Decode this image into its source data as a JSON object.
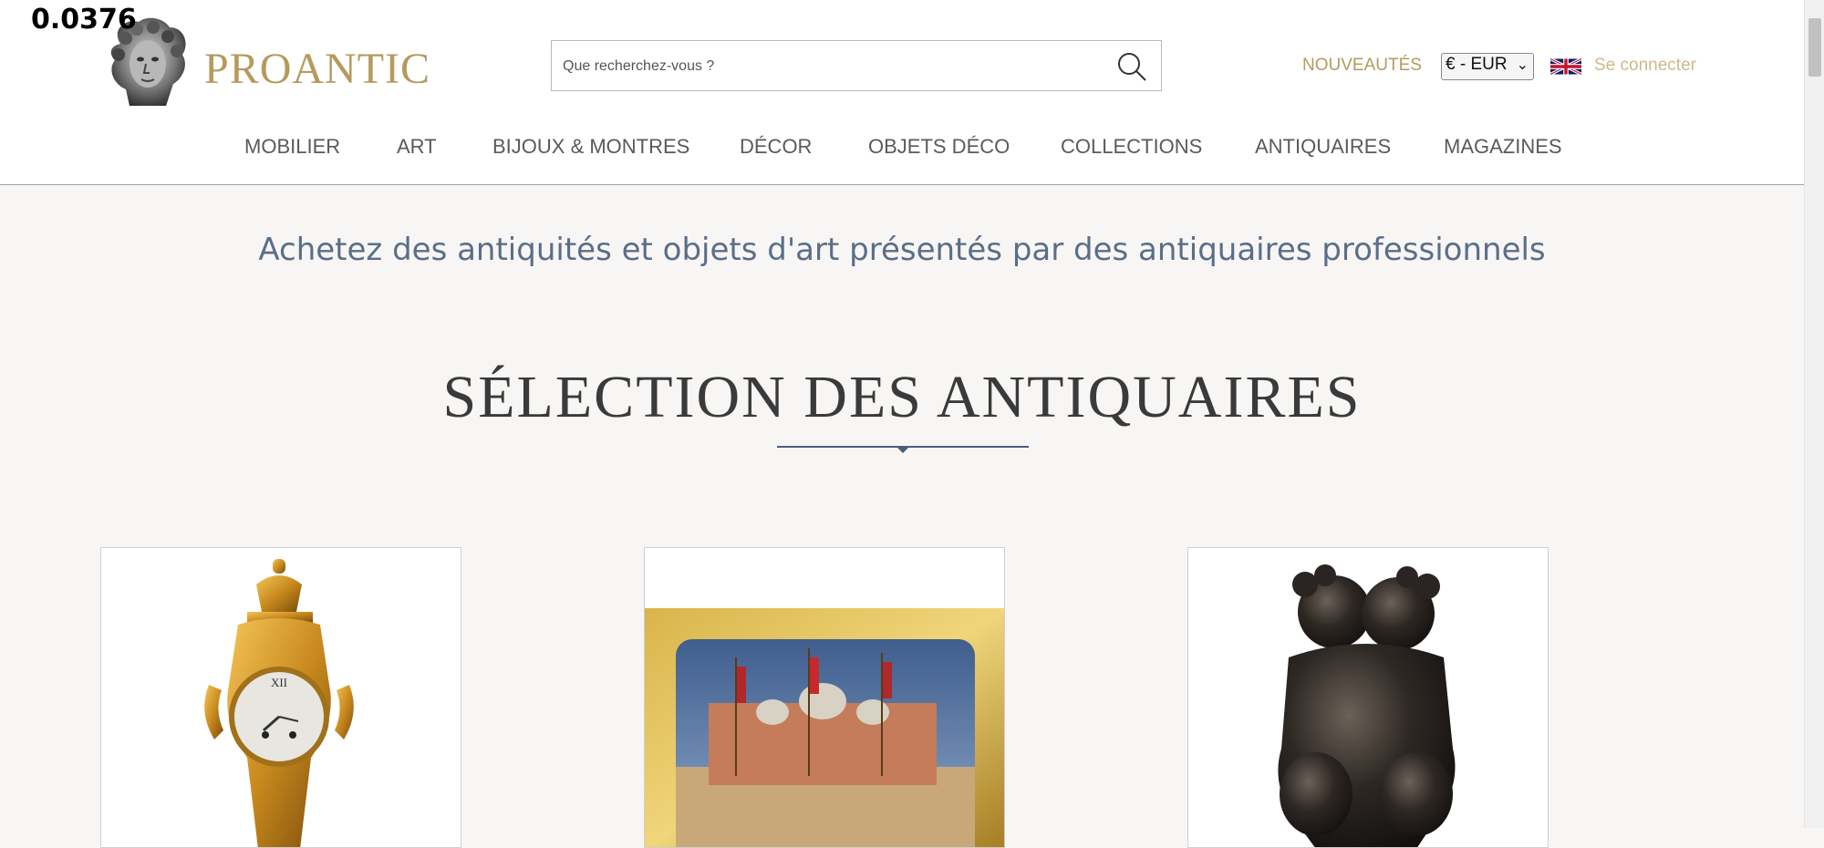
{
  "overlay": {
    "value": "0.0376"
  },
  "header": {
    "logo_text": "PROANTIC",
    "search_placeholder": "Que recherchez-vous ?",
    "new_label": "NOUVEAUTÉS",
    "currency": "€ - EUR",
    "login_label": "Se connecter",
    "language_icon": "uk-flag-icon"
  },
  "nav": {
    "items": [
      "MOBILIER",
      "ART",
      "BIJOUX & MONTRES",
      "DÉCOR",
      "OBJETS DÉCO",
      "COLLECTIONS",
      "ANTIQUAIRES",
      "MAGAZINES"
    ]
  },
  "main": {
    "tagline": "Achetez des antiquités et objets d'art présentés par des antiquaires professionnels",
    "section_title": "SÉLECTION DES ANTIQUAIRES"
  },
  "colors": {
    "accent_gold": "#b59a5e",
    "tagline_blue": "#5a6e88",
    "divider_blue": "#4a5e78",
    "background": "#f7f6f4"
  }
}
